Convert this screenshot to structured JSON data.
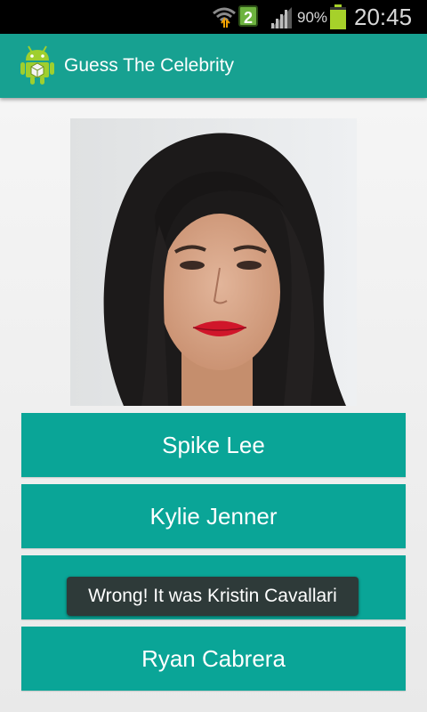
{
  "status_bar": {
    "notification_count": "2",
    "battery_percent": "90%",
    "time": "20:45"
  },
  "action_bar": {
    "title": "Guess The Celebrity",
    "icon": "android-app-icon"
  },
  "answers": [
    {
      "label": "Spike Lee"
    },
    {
      "label": "Kylie Jenner"
    },
    {
      "label": ""
    },
    {
      "label": "Ryan Cabrera"
    }
  ],
  "toast": {
    "message": "Wrong! It was Kristin Cavallari"
  },
  "colors": {
    "action_bar": "#17a191",
    "button": "#0aa597",
    "toast": "#323232"
  }
}
